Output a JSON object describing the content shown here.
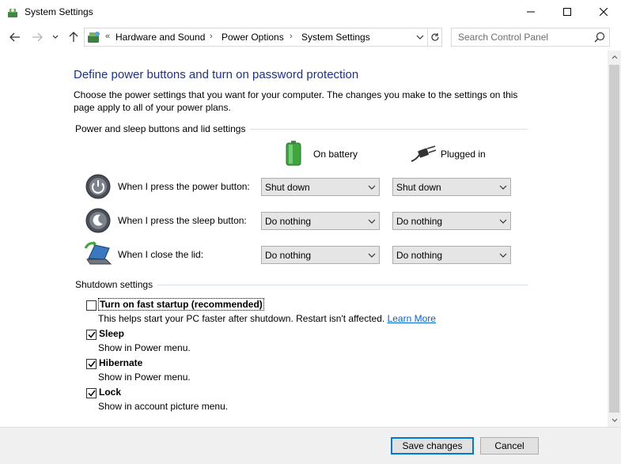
{
  "window": {
    "title": "System Settings",
    "minimize_icon": "minimize-icon",
    "maximize_icon": "maximize-icon",
    "close_icon": "close-icon"
  },
  "nav": {
    "breadcrumb": [
      "Hardware and Sound",
      "Power Options",
      "System Settings"
    ],
    "search_placeholder": "Search Control Panel"
  },
  "page": {
    "title": "Define power buttons and turn on password protection",
    "description": "Choose the power settings that you want for your computer. The changes you make to the settings on this page apply to all of your power plans."
  },
  "power_section": {
    "label": "Power and sleep buttons and lid settings",
    "columns": {
      "battery": "On battery",
      "plugged": "Plugged in"
    },
    "rows": [
      {
        "label": "When I press the power button:",
        "battery": "Shut down",
        "plugged": "Shut down",
        "icon": "power-button-icon"
      },
      {
        "label": "When I press the sleep button:",
        "battery": "Do nothing",
        "plugged": "Do nothing",
        "icon": "sleep-button-icon"
      },
      {
        "label": "When I close the lid:",
        "battery": "Do nothing",
        "plugged": "Do nothing",
        "icon": "laptop-lid-icon"
      }
    ]
  },
  "shutdown_section": {
    "label": "Shutdown settings",
    "items": [
      {
        "label": "Turn on fast startup (recommended)",
        "desc": "This helps start your PC faster after shutdown. Restart isn't affected.",
        "link": "Learn More",
        "checked": false
      },
      {
        "label": "Sleep",
        "desc": "Show in Power menu.",
        "checked": true
      },
      {
        "label": "Hibernate",
        "desc": "Show in Power menu.",
        "checked": true
      },
      {
        "label": "Lock",
        "desc": "Show in account picture menu.",
        "checked": true
      }
    ]
  },
  "footer": {
    "save": "Save changes",
    "cancel": "Cancel"
  },
  "colors": {
    "title_blue": "#1e3287",
    "link_blue": "#0066cc",
    "primary_border": "#0078d7"
  }
}
